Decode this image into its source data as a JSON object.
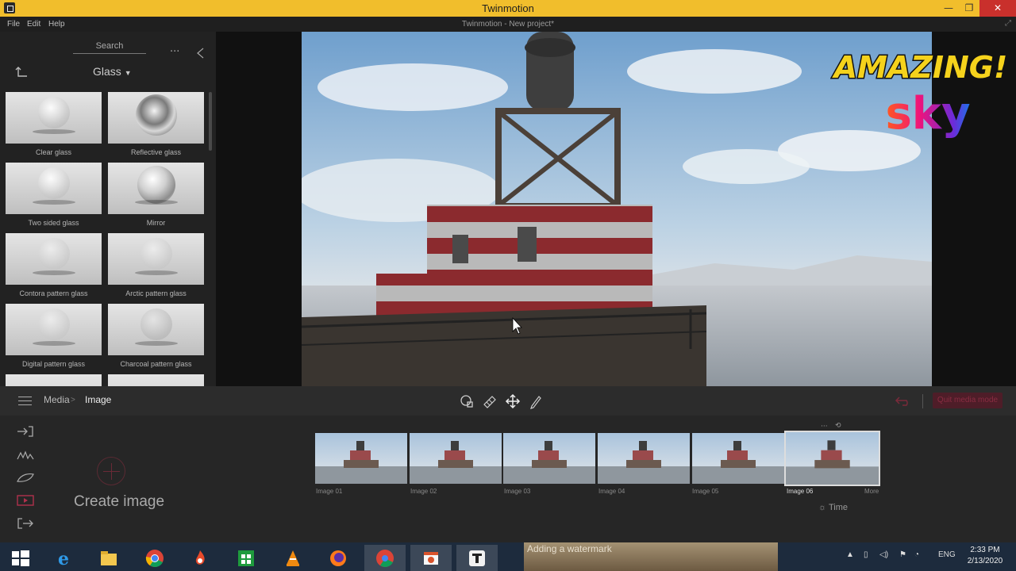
{
  "window": {
    "title": "Twinmotion",
    "controls": {
      "minimize": "—",
      "maximize": "❐",
      "close": "✕"
    }
  },
  "menubar": {
    "items": [
      "File",
      "Edit",
      "Help"
    ],
    "project_title": "Twinmotion - New project*"
  },
  "library": {
    "search_label": "Search",
    "category": "Glass",
    "materials": [
      "Clear glass",
      "Reflective glass",
      "Two sided glass",
      "Mirror",
      "Contora pattern glass",
      "Arctic pattern glass",
      "Digital pattern glass",
      "Charcoal pattern glass"
    ]
  },
  "media_bar": {
    "breadcrumb_root": "Media",
    "breadcrumb_separator": ">",
    "breadcrumb_current": "Image",
    "quit_label": "Quit media mode"
  },
  "media_panel": {
    "create_label": "Create image",
    "images": [
      "Image 01",
      "Image 02",
      "Image 03",
      "Image 04",
      "Image 05",
      "Image 06"
    ],
    "selected_index": 5,
    "more_label": "More",
    "time_label": "Time"
  },
  "overlay": {
    "headline": "AMAZING!",
    "subhead": "sky"
  },
  "taskbar": {
    "watermark_text": "Adding a watermark",
    "language": "ENG",
    "time": "2:33 PM",
    "date": "2/13/2020"
  },
  "colors": {
    "titlebar": "#f1be2c",
    "accent": "#8a2c42",
    "taskbar": "#1d2b3d"
  }
}
